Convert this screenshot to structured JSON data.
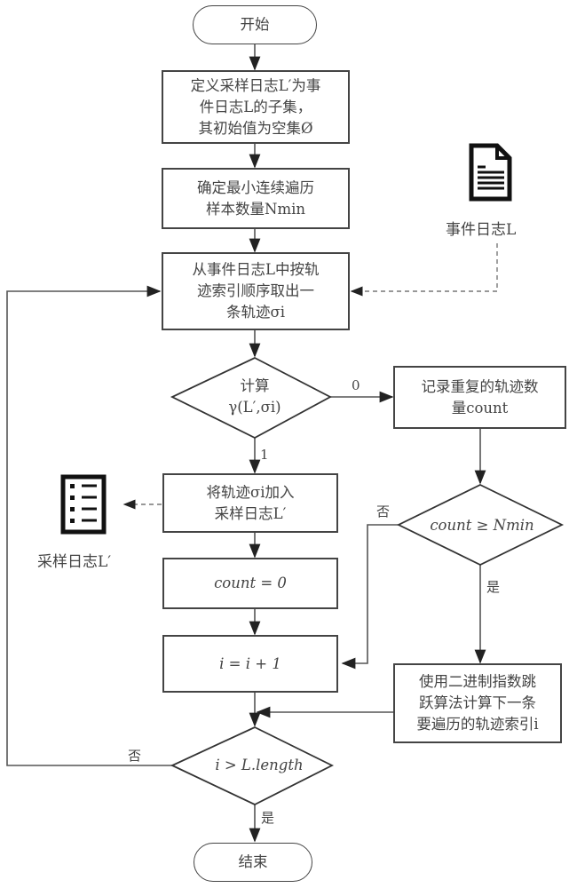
{
  "nodes": {
    "start": "开始",
    "define_sample": "定义采样日志L′为事\n件日志L的子集，\n其初始值为空集Ø",
    "determine_nmin": "确定最小连续遍历\n样本数量Nmin",
    "take_trace": "从事件日志L中按轨\n迹索引顺序取出一\n条轨迹σi",
    "compute_gamma": "计算\nγ(L′,σi)",
    "record_repeat": "记录重复的轨迹数\n量count",
    "add_trace": "将轨迹σi加入\n采样日志L′",
    "count_check": "count ≥ Nmin",
    "reset_count": "count = 0",
    "increment_i": "i = i + 1",
    "binary_jump": "使用二进制指数跳\n跃算法计算下一条\n要遍历的轨迹索引i",
    "length_check": "i > L.length",
    "end": "结束"
  },
  "edge_labels": {
    "gamma_zero": "0",
    "gamma_one": "1",
    "count_no": "否",
    "count_yes": "是",
    "length_no": "否",
    "length_yes": "是"
  },
  "artifacts": {
    "event_log": "事件日志L",
    "sample_log": "采样日志L′"
  }
}
